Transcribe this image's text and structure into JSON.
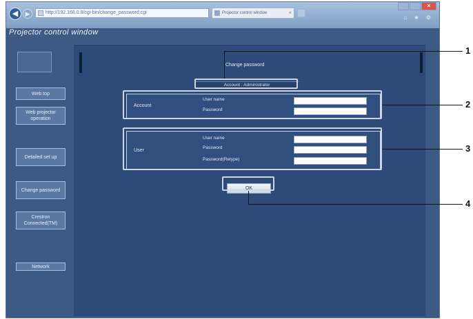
{
  "browser": {
    "address_text": "http://192.168.0.8/cgi-bin/change_password.cgi",
    "tab_title": "Projector control window",
    "tab_close": "×",
    "back_glyph": "◀",
    "forward_glyph": "▶",
    "close_glyph": "✕",
    "toolbar_glyphs": "⌂ ★ ⚙"
  },
  "app_title": "Projector control window",
  "sidebar": {
    "buttons": [
      "Web top",
      "Web projector operation",
      "Detailed set up",
      "Change password",
      "Crestron Connected(TM)",
      "Network"
    ]
  },
  "main": {
    "heading": "Change password",
    "tab_strip": "Account : Administrator",
    "administrator": {
      "label": "Account",
      "fields": [
        "User name",
        "Password"
      ]
    },
    "user": {
      "label": "User",
      "fields": [
        "User name",
        "Password",
        "Password(Retype)"
      ]
    },
    "ok_label": "OK"
  },
  "callouts": [
    "1",
    "2",
    "3",
    "4"
  ],
  "colors": {
    "window_bg": "#3d5a85",
    "main_bg": "#2e4a78",
    "section_bg": "#304e7e",
    "highlight": "#cfd6e0"
  }
}
